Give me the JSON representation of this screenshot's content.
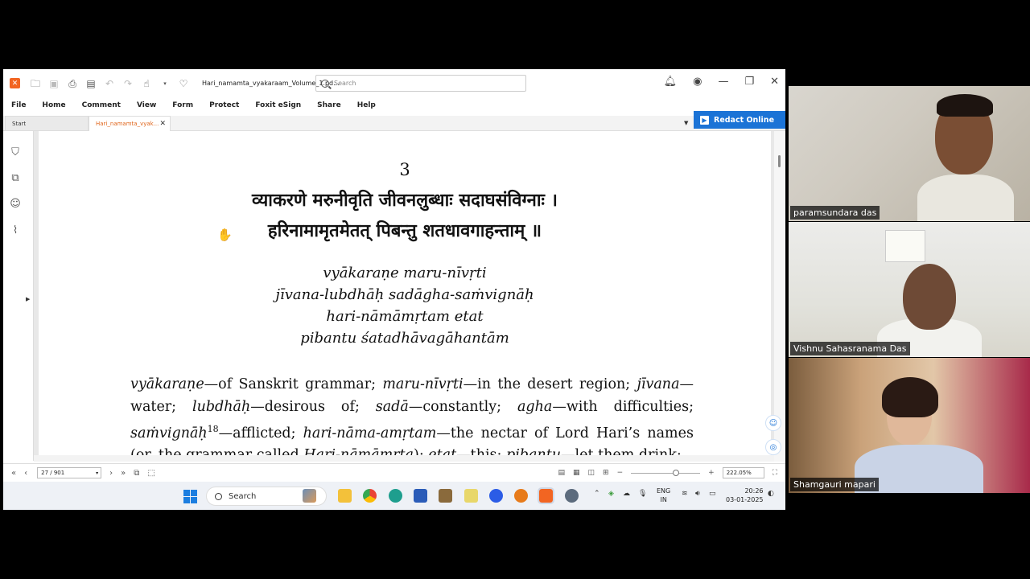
{
  "window": {
    "doc_title": "Hari_namamta_vyakaraam_Volume_1.pd...",
    "search_placeholder": "Search"
  },
  "menu": [
    "File",
    "Home",
    "Comment",
    "View",
    "Form",
    "Protect",
    "Foxit eSign",
    "Share",
    "Help"
  ],
  "tabs": {
    "start": "Start",
    "doc": "Hari_namamta_vyak..."
  },
  "redact_label": "Redact Online",
  "document": {
    "page_number": "3",
    "sanskrit_line1": "व्याकरणे मरुनीवृति जीवनलुब्धाः सदाघसंविग्नाः ।",
    "sanskrit_line2": "हरिनामामृतमेतत् पिबन्तु शतधावगाहन्ताम् ॥",
    "translit": [
      "vyākaraṇe maru-nīvṛti",
      "jīvana-lubdhāḥ sadāgha-saṁvignāḥ",
      "hari-nāmāmṛtam etat",
      "pibantu śatadhāvagāhantām"
    ],
    "prose": {
      "w1": "vyākaraṇe",
      "g1": "—of Sanskrit grammar; ",
      "w2": "maru-nīvṛti",
      "g2": "—in the desert region; ",
      "w3": "jīvana",
      "g3": "—water; ",
      "w4": "lubdhāḥ",
      "g4": "—desirous of; ",
      "w5": "sadā",
      "g5": "—constantly; ",
      "w6": "agha",
      "g6": "—with difficulties; ",
      "w7": "saṁvignāḥ",
      "fn": "18",
      "g7": "—afflicted; ",
      "w8": "hari-nāma-amṛtam",
      "g8": "—the nectar of Lord Hari’s names (or, the grammar called ",
      "w9": "Hari-nāmāmṛta",
      "g9": "); ",
      "w10": "etat",
      "g10": "—this; ",
      "w11": "pibantu",
      "g11": "—let them drink;"
    }
  },
  "status": {
    "page_box": "27 / 901",
    "zoom": "222.05%"
  },
  "taskbar": {
    "search": "Search",
    "lang1": "ENG",
    "lang2": "IN",
    "time": "20:26",
    "date": "03-01-2025"
  },
  "participants": [
    {
      "name": "paramsundara das"
    },
    {
      "name": "Vishnu Sahasranama Das"
    },
    {
      "name": "Shamgauri mapari"
    }
  ],
  "colors": {
    "foxit_orange": "#f26522",
    "redact_blue": "#1b73d6",
    "active_tab_text": "#e0651b"
  }
}
